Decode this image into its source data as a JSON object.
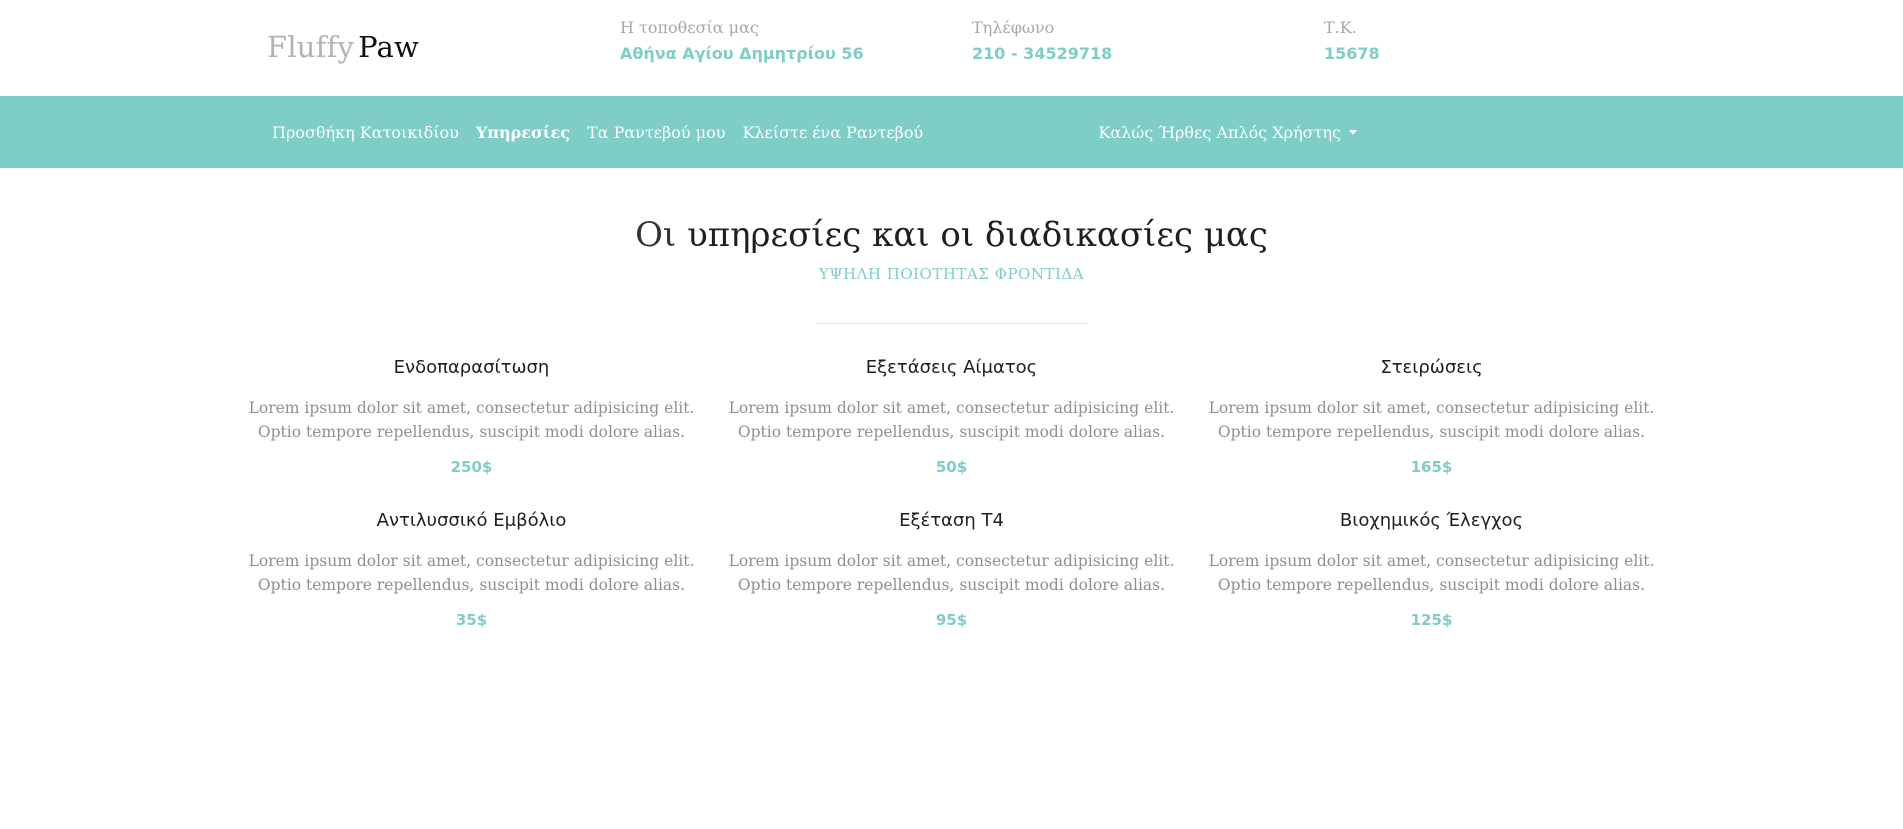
{
  "brand": {
    "light": "Fluffy",
    "dark": "Paw"
  },
  "header_info": {
    "location": {
      "label": "Η τοποθεσία μας",
      "value": "Αθήνα Αγίου Δημητρίου 56"
    },
    "phone": {
      "label": "Τηλέφωνο",
      "value": "210 - 34529718"
    },
    "zip": {
      "label": "Τ.Κ.",
      "value": "15678"
    }
  },
  "nav": {
    "items": [
      {
        "label": "Προσθήκη Κατοικιδίου"
      },
      {
        "label": "Υπηρεσίες"
      },
      {
        "label": "Τα Ραντεβού μου"
      },
      {
        "label": "Κλείστε ένα Ραντεβού"
      }
    ],
    "active": "Υπηρεσίες",
    "user_menu": "Καλώς Ήρθες Απλός Χρήστης"
  },
  "hero": {
    "title_light": "Οι",
    "title_main": "υπηρεσίες και οι διαδικασίες μας",
    "subtitle": "ΥΨΗΛΗ ΠΟΙΟΤΗΤΑΣ ΦΡΟΝΤΙΔΑ"
  },
  "services": [
    {
      "title": "Ενδοπαρασίτωση",
      "desc_1": "Lorem ipsum dolor sit amet, consectetur adipisicing elit.",
      "desc_2": "Optio tempore repellendus, suscipit modi dolore alias.",
      "price": "250$"
    },
    {
      "title": "Εξετάσεις Αίματος",
      "desc_1": "Lorem ipsum dolor sit amet, consectetur adipisicing elit.",
      "desc_2": "Optio tempore repellendus, suscipit modi dolore alias.",
      "price": "50$"
    },
    {
      "title": "Στειρώσεις",
      "desc_1": "Lorem ipsum dolor sit amet, consectetur adipisicing elit.",
      "desc_2": "Optio tempore repellendus, suscipit modi dolore alias.",
      "price": "165$"
    },
    {
      "title": "Αντιλυσσικό Εμβόλιο",
      "desc_1": "Lorem ipsum dolor sit amet, consectetur adipisicing elit.",
      "desc_2": "Optio tempore repellendus, suscipit modi dolore alias.",
      "price": "35$"
    },
    {
      "title": "Εξέταση Τ4",
      "desc_1": "Lorem ipsum dolor sit amet, consectetur adipisicing elit.",
      "desc_2": "Optio tempore repellendus, suscipit modi dolore alias.",
      "price": "95$"
    },
    {
      "title": "Βιοχημικός Έλεγχος",
      "desc_1": "Lorem ipsum dolor sit amet, consectetur adipisicing elit.",
      "desc_2": "Optio tempore repellendus, suscipit modi dolore alias.",
      "price": "125$"
    }
  ],
  "colors": {
    "accent": "#7fcdc7",
    "text_muted": "#8f8f8f"
  }
}
